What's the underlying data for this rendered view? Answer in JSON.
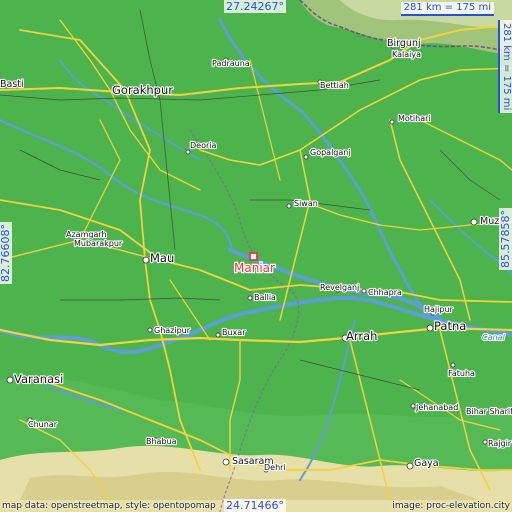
{
  "map": {
    "coords": {
      "top": "27.24267°",
      "bottom": "24.71466°",
      "left": "82.76608°",
      "right": "85.57858°"
    },
    "scale_h": "281 km = 175 mi",
    "scale_v": "281 km = 175 mi",
    "highlight_city": "Maniar",
    "credits": {
      "left": "map data: openstreetmap, style: opentopomap",
      "right": "image: proc-elevation.city"
    },
    "colors": {
      "land": "#4db34d",
      "water": "#5b9fd6",
      "road": "#f2d33c",
      "highlight": "#e23b3b",
      "coord_text": "#2a4fd8"
    },
    "cities": {
      "basti": "Basti",
      "gorakhpur": "Gorakhpur",
      "padrauna": "Padrauna",
      "bettiah": "Bettiah",
      "birgunj": "Birgunj",
      "kalaiya": "Kalaiya",
      "motihari": "Motihari",
      "deoria": "Deoria",
      "gopalganj": "Gopalganj",
      "siwan": "Siwan",
      "muza": "Muza",
      "azamgarh": "Azamgarh",
      "mubarakpur": "Mubarakpur",
      "mau": "Mau",
      "ballia": "Ballia",
      "revelganj": "Revelganj",
      "chhapra": "Chhapra",
      "hajipur": "Hajipur",
      "patna": "Patna",
      "ghazipur": "Ghazipur",
      "buxar": "Buxar",
      "arrah": "Arrah",
      "fatuha": "Fatuha",
      "varanasi": "Varanasi",
      "chunar": "Chunar",
      "jehanabad": "Jehanabad",
      "bihar_sharif": "Bihar Sharif",
      "rajgir": "Rajgir",
      "bhabua": "Bhabua",
      "sasaram": "Sasaram",
      "dehri": "Dehri",
      "gaya": "Gaya",
      "canal": "Canal"
    }
  }
}
